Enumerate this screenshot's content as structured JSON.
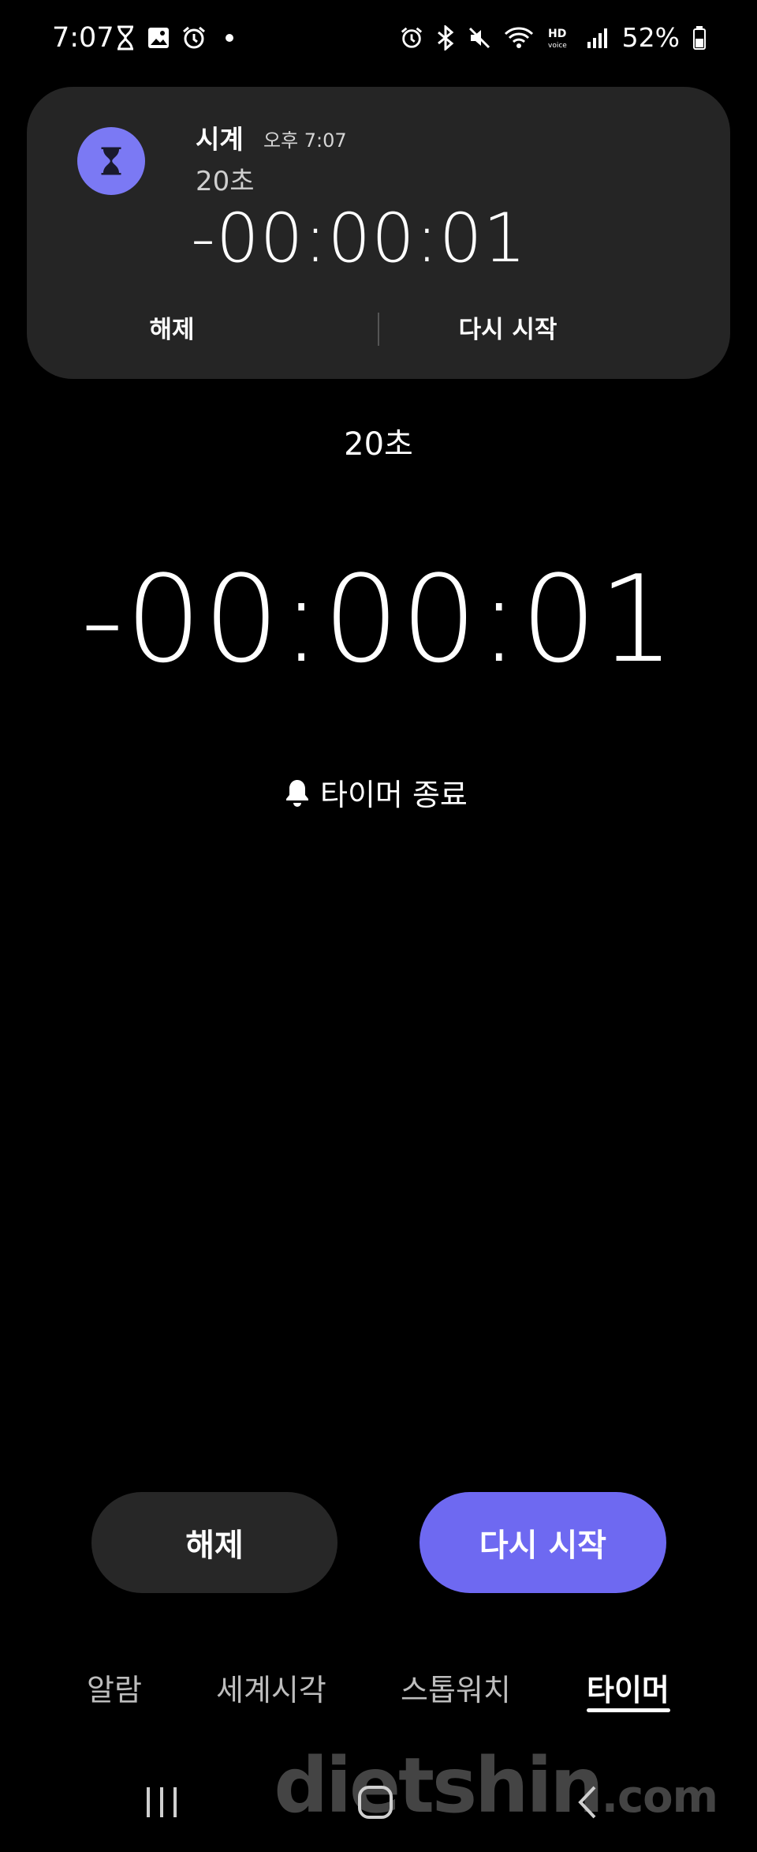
{
  "status_bar": {
    "time": "7:07",
    "left_icons": [
      "hourglass-icon",
      "gallery-icon",
      "alarm-icon",
      "dot-icon"
    ],
    "right_icons": [
      "alarm-icon",
      "bluetooth-icon",
      "mute-icon",
      "wifi-icon",
      "hd-voice-icon",
      "signal-icon",
      "battery-icon"
    ],
    "battery": "52%",
    "hd_voice": "HD"
  },
  "notification": {
    "app_name": "시계",
    "time": "오후 7:07",
    "label": "20초",
    "countdown": "-00:00:01",
    "actions": {
      "dismiss": "해제",
      "restart": "다시 시작"
    },
    "icon_color": "#7b79f4"
  },
  "timer": {
    "label": "20초",
    "countdown": "-00:00:01",
    "status": "타이머 종료"
  },
  "buttons": {
    "dismiss": "해제",
    "restart": "다시 시작",
    "accent_color": "#6e69f1"
  },
  "tabs": [
    {
      "label": "알람",
      "active": false
    },
    {
      "label": "세계시각",
      "active": false
    },
    {
      "label": "스톱워치",
      "active": false
    },
    {
      "label": "타이머",
      "active": true
    }
  ],
  "watermark": {
    "main": "dietshin",
    "suffix": ".com"
  }
}
